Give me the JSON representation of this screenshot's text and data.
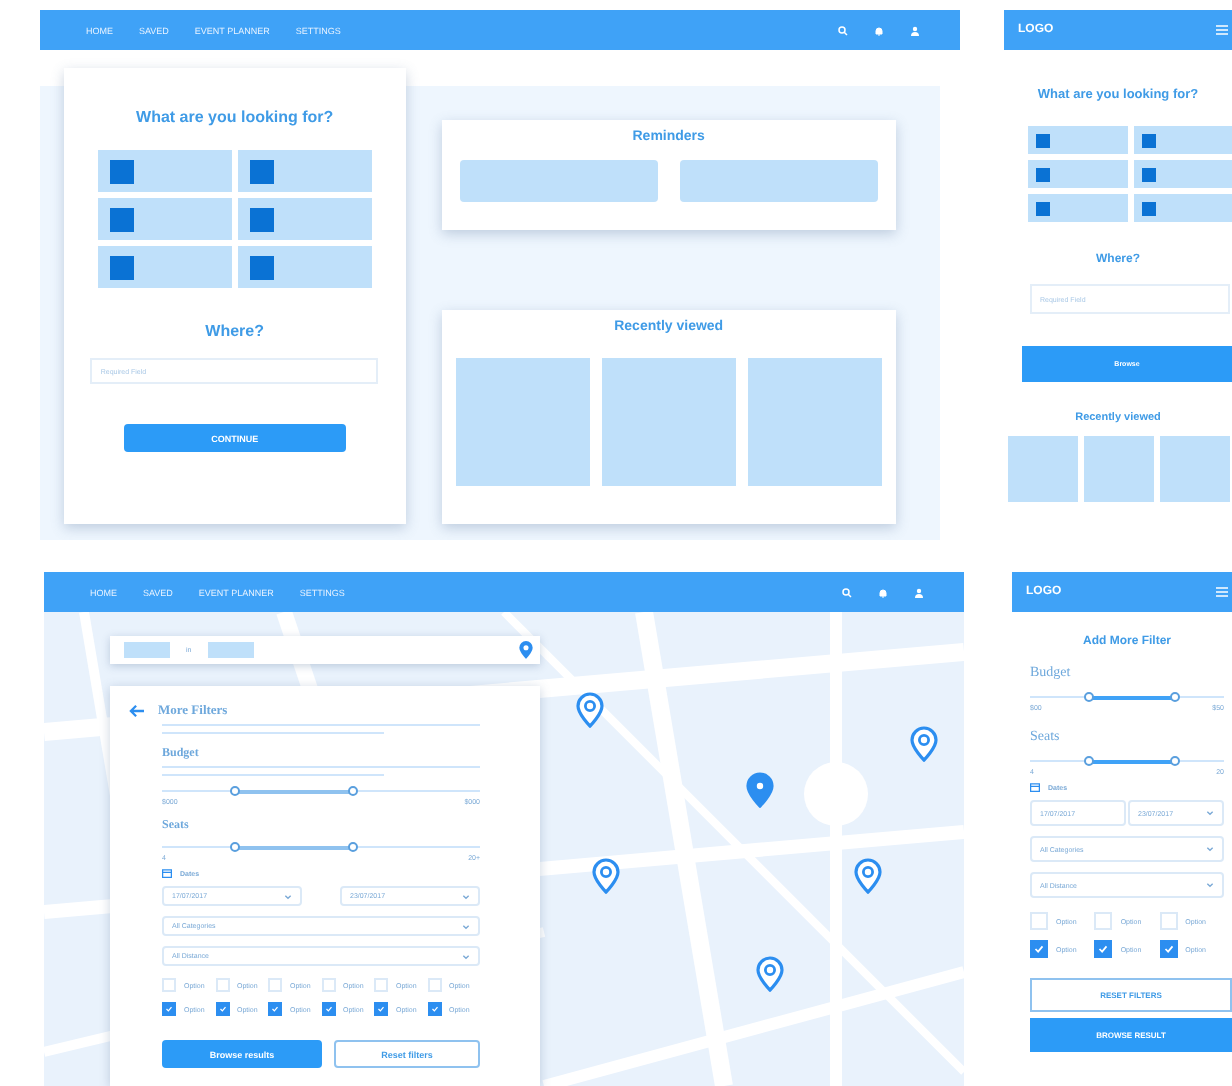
{
  "desktop_home": {
    "nav": [
      "HOME",
      "SAVED",
      "EVENT PLANNER",
      "SETTINGS"
    ],
    "search_card": {
      "title": "What are you looking for?",
      "where_title": "Where?",
      "placeholder": "Required Field",
      "button": "CONTINUE"
    },
    "reminders": {
      "title": "Reminders"
    },
    "recent": {
      "title": "Recently viewed"
    }
  },
  "mobile_home": {
    "logo": "LOGO",
    "title": "What are you looking for?",
    "where_title": "Where?",
    "placeholder": "Required Field",
    "button": "Browse",
    "recent_title": "Recently viewed"
  },
  "desktop_filters": {
    "nav": [
      "HOME",
      "SAVED",
      "EVENT PLANNER",
      "SETTINGS"
    ],
    "search_joiner": "in",
    "title": "More Filters",
    "budget": {
      "label": "Budget",
      "thumbs": [
        {
          "level": 0.23
        },
        {
          "level": 0.6
        }
      ],
      "min": "$000",
      "max": "$000"
    },
    "seats": {
      "label": "Seats",
      "thumbs": [
        {
          "level": 0.23
        },
        {
          "level": 0.6
        }
      ],
      "min": "4",
      "max": "20+"
    },
    "dates_label": "Dates",
    "date_from": "17/07/2017",
    "date_to": "23/07/2017",
    "category": "All Categories",
    "distance": "All Distance",
    "options": [
      {
        "label": "Option",
        "checked": false
      },
      {
        "label": "Option",
        "checked": false
      },
      {
        "label": "Option",
        "checked": false
      },
      {
        "label": "Option",
        "checked": false
      },
      {
        "label": "Option",
        "checked": false
      },
      {
        "label": "Option",
        "checked": false
      },
      {
        "label": "Option",
        "checked": true
      },
      {
        "label": "Option",
        "checked": true
      },
      {
        "label": "Option",
        "checked": true
      },
      {
        "label": "Option",
        "checked": true
      },
      {
        "label": "Option",
        "checked": true
      },
      {
        "label": "Option",
        "checked": true
      }
    ],
    "browse": "Browse results",
    "reset": "Reset filters"
  },
  "mobile_filters": {
    "logo": "LOGO",
    "title": "Add More Filter",
    "budget": {
      "label": "Budget",
      "thumbs": [
        {
          "level": 0.3
        },
        {
          "level": 0.75
        }
      ],
      "min": "$00",
      "max": "$50"
    },
    "seats": {
      "label": "Seats",
      "thumbs": [
        {
          "level": 0.3
        },
        {
          "level": 0.75
        }
      ],
      "min": "4",
      "max": "20"
    },
    "dates_label": "Dates",
    "date_from": "17/07/2017",
    "date_to": "23/07/2017",
    "category": "All Categories",
    "distance": "All Distance",
    "options": [
      {
        "label": "Option",
        "checked": false
      },
      {
        "label": "Option",
        "checked": false
      },
      {
        "label": "Option",
        "checked": false
      },
      {
        "label": "Option",
        "checked": true
      },
      {
        "label": "Option",
        "checked": true
      },
      {
        "label": "Option",
        "checked": true
      }
    ],
    "reset": "RESET FILTERS",
    "browse": "BROWSE RESULT"
  }
}
